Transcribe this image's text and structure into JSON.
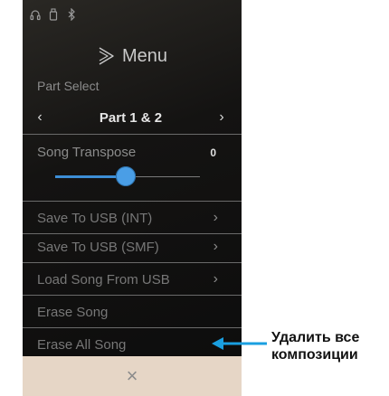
{
  "status_bar": {
    "icons": [
      "headphones-icon",
      "usb-stick-icon",
      "bluetooth-icon"
    ]
  },
  "header": {
    "icon": "play-outline-icon",
    "title": "Menu"
  },
  "part_select": {
    "label": "Part Select",
    "prev_icon": "‹",
    "value": "Part 1 & 2",
    "next_icon": "›"
  },
  "song_transpose": {
    "label": "Song Transpose",
    "value": "0",
    "slider_level": 0.5
  },
  "menu_items": [
    {
      "label": "Save To USB (INT)",
      "chevron": "›"
    },
    {
      "label": "Save To USB (SMF)",
      "chevron": "›"
    },
    {
      "label": "Load Song From USB",
      "chevron": "›"
    },
    {
      "label": "Erase Song",
      "chevron": ""
    },
    {
      "label": "Erase All Song",
      "chevron": ""
    }
  ],
  "bottom_bar": {
    "close_glyph": "×"
  },
  "callout": {
    "line1": "Удалить все",
    "line2": "композиции",
    "arrow_color": "#1a9fe0"
  },
  "colors": {
    "accent": "#3d8ed6",
    "bottom_bar": "#e6d6c6",
    "background_dark": "#141312"
  }
}
